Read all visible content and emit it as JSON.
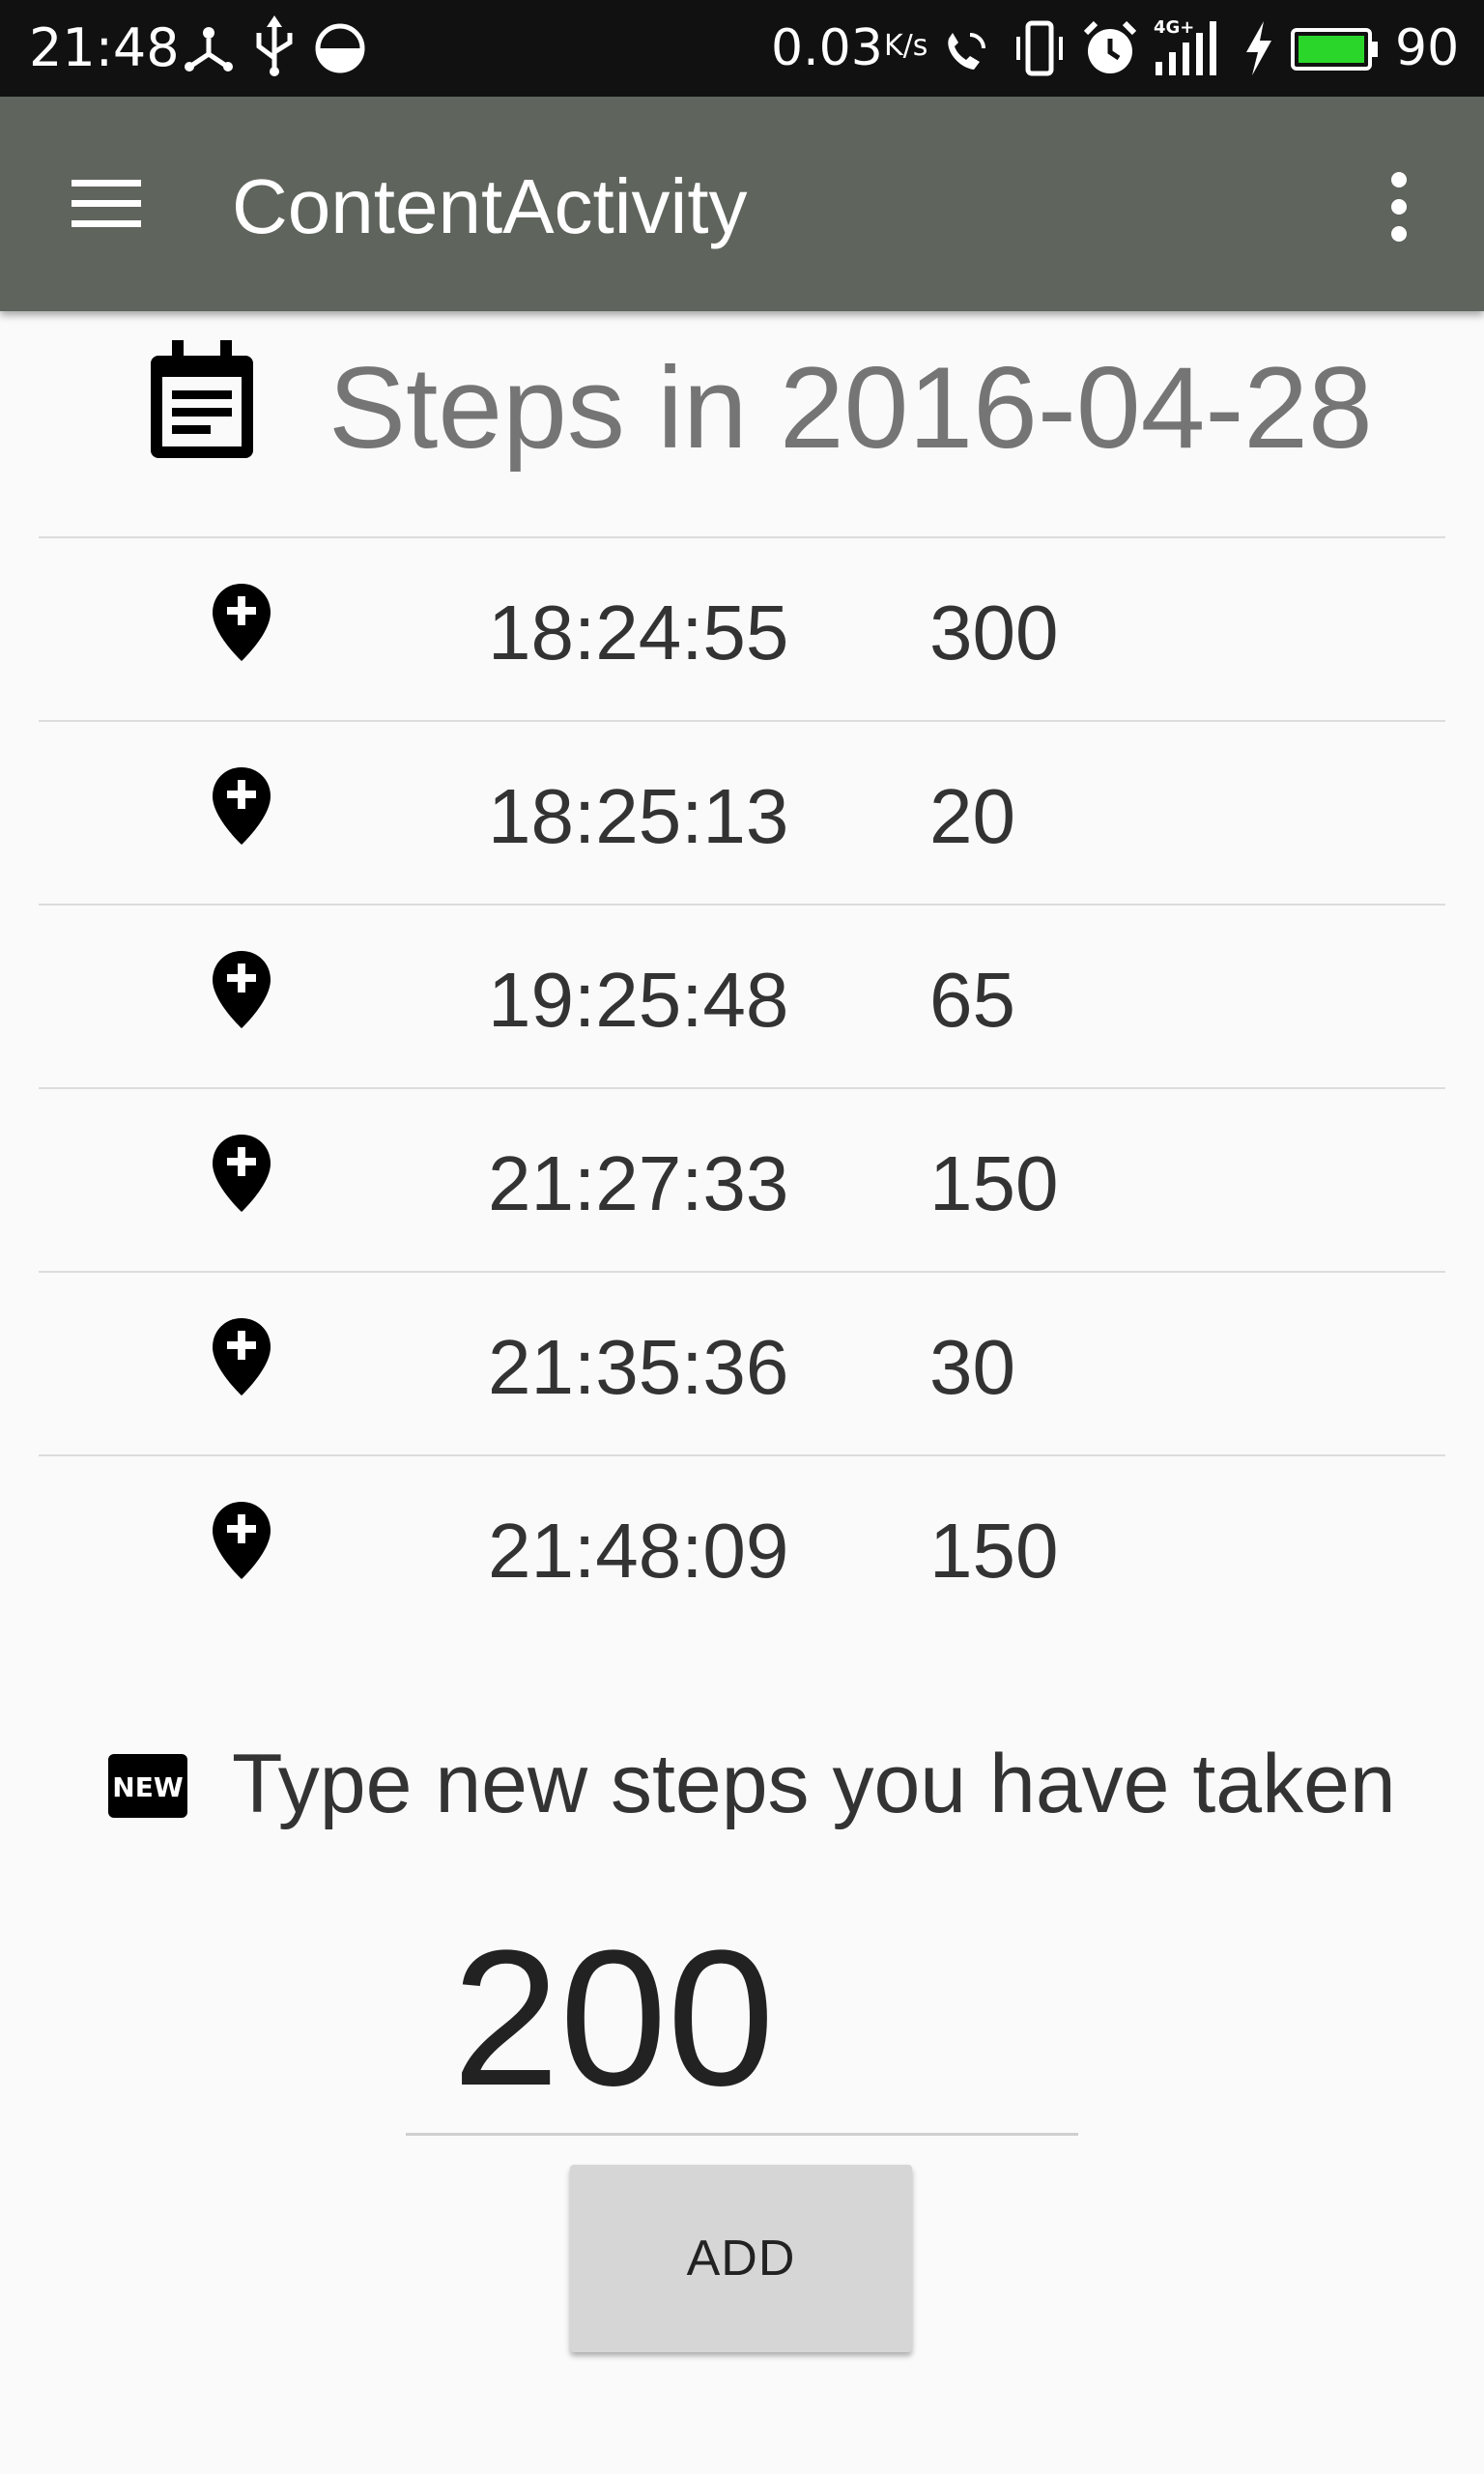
{
  "status_bar": {
    "time": "21:48",
    "net_speed": "0.03",
    "net_speed_unit": "K/s",
    "battery_percent": "90",
    "icons": [
      "usb-hub-icon",
      "usb-icon",
      "data-saver-icon",
      "wifi-call-icon",
      "vibrate-icon",
      "alarm-icon",
      "signal-4g-icon",
      "charging-icon",
      "battery-icon"
    ],
    "battery_color": "#2bd62b"
  },
  "app_bar": {
    "title": "ContentActivity",
    "background": "#5f645d"
  },
  "header": {
    "title": "Steps in 2016-04-28",
    "icon": "calendar-icon"
  },
  "steps": [
    {
      "time": "18:24:55",
      "count": "300"
    },
    {
      "time": "18:25:13",
      "count": "20"
    },
    {
      "time": "19:25:48",
      "count": "65"
    },
    {
      "time": "21:27:33",
      "count": "150"
    },
    {
      "time": "21:35:36",
      "count": "30"
    },
    {
      "time": "21:48:09",
      "count": "150"
    }
  ],
  "new_entry": {
    "icon": "new-badge-icon",
    "label": "Type new steps you have taken",
    "value": "200",
    "button_label": "ADD"
  }
}
